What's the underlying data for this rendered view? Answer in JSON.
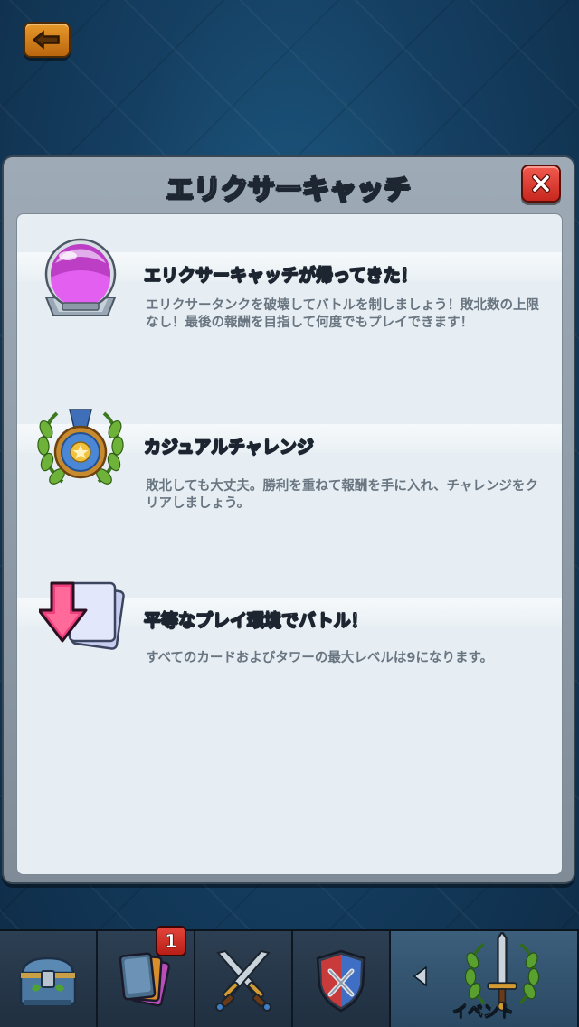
{
  "header": {
    "back_icon": "back-arrow-icon"
  },
  "modal": {
    "title": "エリクサーキャッチ",
    "close_icon": "close-x-icon",
    "features": [
      {
        "icon": "elixir-tank-icon",
        "title": "エリクサーキャッチが帰ってきた！",
        "description": "エリクサータンクを破壊してバトルを制しましょう！敗北数の上限なし！最後の報酬を目指して何度でもプレイできます！"
      },
      {
        "icon": "laurel-medal-icon",
        "title": "カジュアルチャレンジ",
        "description": "敗北しても大丈夫。勝利を重ねて報酬を手に入れ、チャレンジをクリアしましょう。"
      },
      {
        "icon": "level-down-cards-icon",
        "title": "平等なプレイ環境でバトル！",
        "description": "すべてのカードおよびタワーの最大レベルは9になります。"
      }
    ]
  },
  "bottom_nav": {
    "tabs": [
      {
        "icon": "chest-shop-icon"
      },
      {
        "icon": "cards-icon",
        "badge": "1"
      },
      {
        "icon": "crossed-swords-icon"
      },
      {
        "icon": "clan-shield-icon"
      },
      {
        "icon": "event-sword-laurel-icon",
        "label": "イベント"
      }
    ]
  },
  "colors": {
    "accent_title_text": "#ffffff",
    "description_text": "#697580",
    "close_button": "#d8342a",
    "back_button": "#d98420",
    "badge": "#d2332a"
  }
}
